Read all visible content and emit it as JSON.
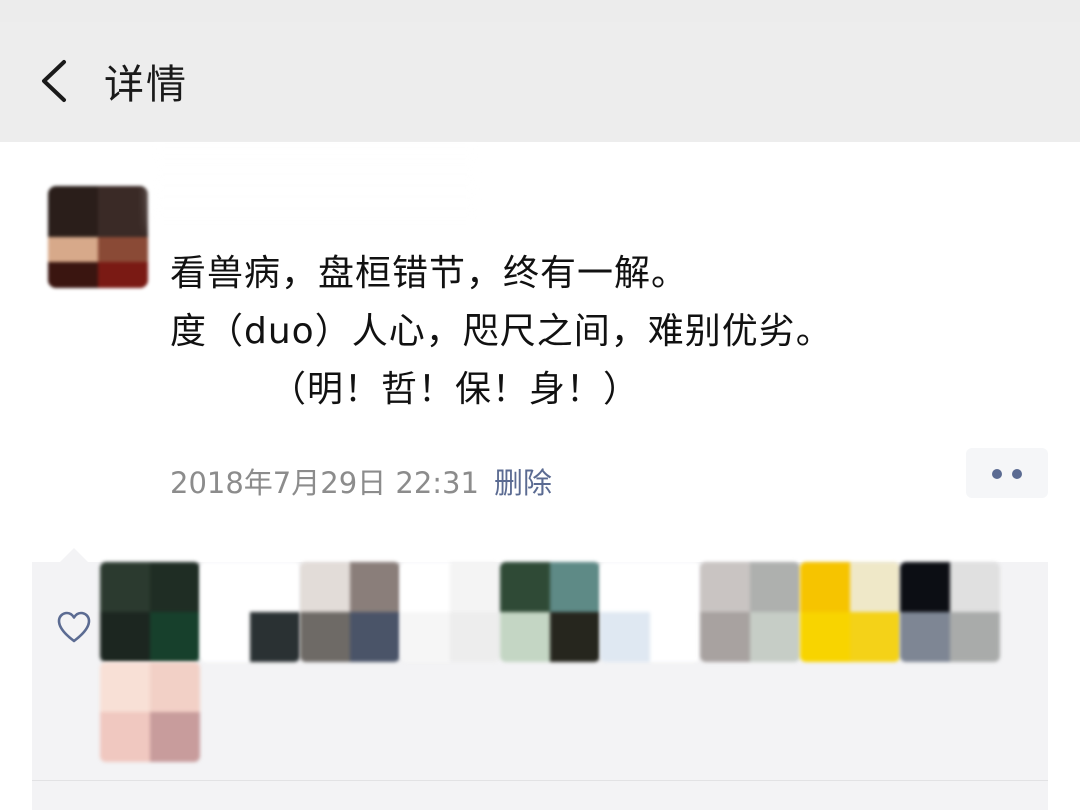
{
  "nav": {
    "title": "详情"
  },
  "post": {
    "lines": [
      "看兽病，盘桓错节，终有一解。",
      "度（duo）人心，咫尺之间，难别优劣。",
      "（明！哲！保！身！）"
    ],
    "timestamp": "2018年7月29日 22:31",
    "delete_label": "删除"
  },
  "colors": {
    "nav_background": "#ededed",
    "link": "#5b6b92",
    "meta_gray": "#8c8c8c",
    "likes_background": "#f3f3f5"
  },
  "icons": {
    "back": "chevron-left-icon",
    "more": "more-dots-icon",
    "like": "heart-icon"
  }
}
